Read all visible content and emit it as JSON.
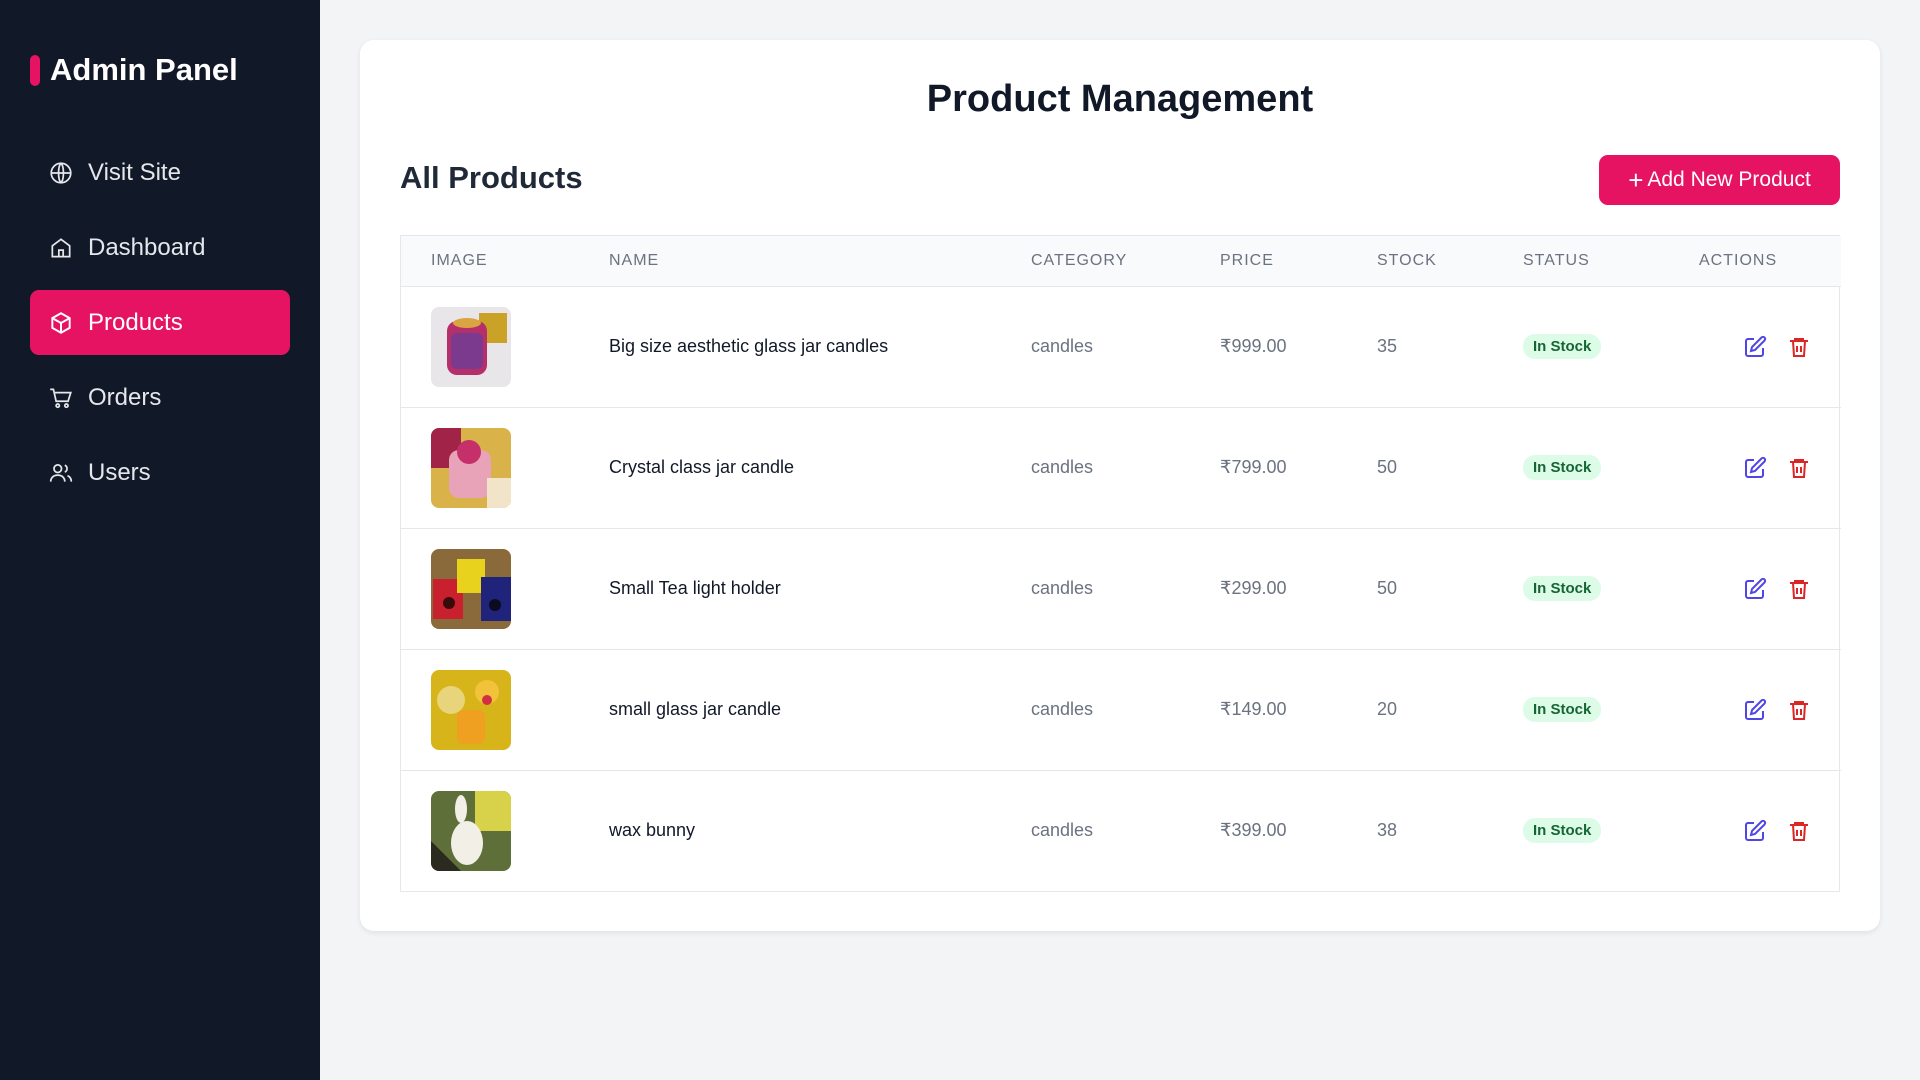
{
  "sidebar": {
    "brand": "Admin Panel",
    "accent": "#e61262",
    "items": [
      {
        "label": "Visit Site",
        "icon": "globe-icon"
      },
      {
        "label": "Dashboard",
        "icon": "home-icon"
      },
      {
        "label": "Products",
        "icon": "box-icon",
        "active": true
      },
      {
        "label": "Orders",
        "icon": "cart-icon"
      },
      {
        "label": "Users",
        "icon": "users-icon"
      }
    ]
  },
  "main": {
    "title": "Product Management",
    "section_title": "All Products",
    "add_button": "Add New Product",
    "table": {
      "headers": [
        "IMAGE",
        "NAME",
        "CATEGORY",
        "PRICE",
        "STOCK",
        "STATUS",
        "ACTIONS"
      ],
      "rows": [
        {
          "name": "Big size aesthetic glass jar candles",
          "category": "candles",
          "price": "₹999.00",
          "stock": "35",
          "status": "In Stock"
        },
        {
          "name": "Crystal class jar candle",
          "category": "candles",
          "price": "₹799.00",
          "stock": "50",
          "status": "In Stock"
        },
        {
          "name": "Small Tea light holder",
          "category": "candles",
          "price": "₹299.00",
          "stock": "50",
          "status": "In Stock"
        },
        {
          "name": "small glass jar candle",
          "category": "candles",
          "price": "₹149.00",
          "stock": "20",
          "status": "In Stock"
        },
        {
          "name": "wax bunny",
          "category": "candles",
          "price": "₹399.00",
          "stock": "38",
          "status": "In Stock"
        }
      ]
    }
  },
  "colors": {
    "sidebar_bg": "#111827",
    "accent": "#e61262",
    "edit_icon": "#4f46e5",
    "delete_icon": "#dc2626",
    "badge_bg": "#dcfce7",
    "badge_text": "#166534"
  }
}
